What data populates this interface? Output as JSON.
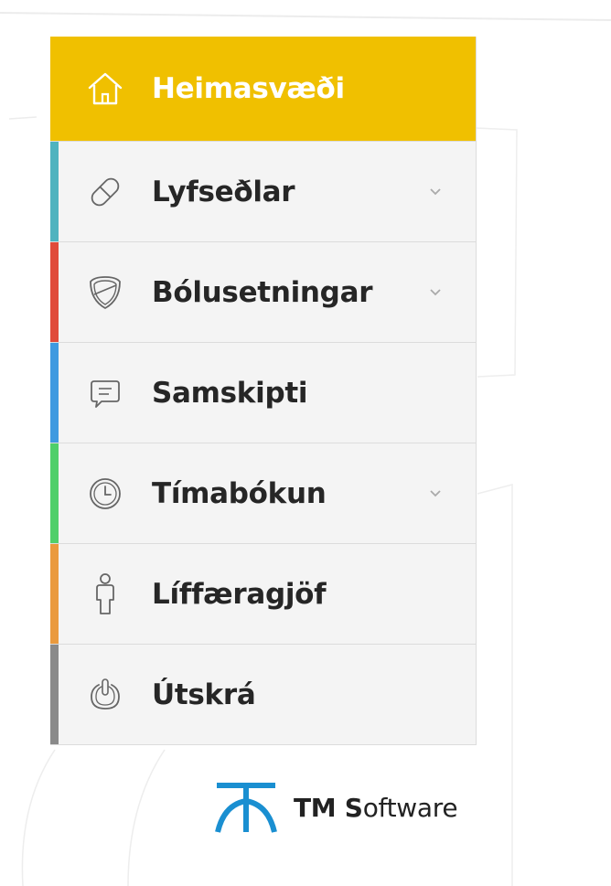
{
  "colors": {
    "home_background": "#f0c000",
    "item_background": "#f4f4f4",
    "label_text": "#262626",
    "logo_blue": "#1a8fd1"
  },
  "nav": {
    "items": [
      {
        "label": "Heimasvæði",
        "icon": "house-icon",
        "accent": "#f0c000",
        "has_dropdown": false
      },
      {
        "label": "Lyfseðlar",
        "icon": "pill-icon",
        "accent": "#4fb3bf",
        "has_dropdown": true
      },
      {
        "label": "Bólusetningar",
        "icon": "shield-icon",
        "accent": "#e04b3a",
        "has_dropdown": true
      },
      {
        "label": "Samskipti",
        "icon": "chat-icon",
        "accent": "#3f9ae0",
        "has_dropdown": false
      },
      {
        "label": "Tímabókun",
        "icon": "clock-icon",
        "accent": "#4fcf6a",
        "has_dropdown": true
      },
      {
        "label": "Líffæragjöf",
        "icon": "person-icon",
        "accent": "#ea9a3e",
        "has_dropdown": false
      },
      {
        "label": "Útskrá",
        "icon": "power-icon",
        "accent": "#8a8a8a",
        "has_dropdown": false
      }
    ]
  },
  "footer": {
    "logo_text_bold": "TM S",
    "logo_text_rest": "oftware"
  }
}
